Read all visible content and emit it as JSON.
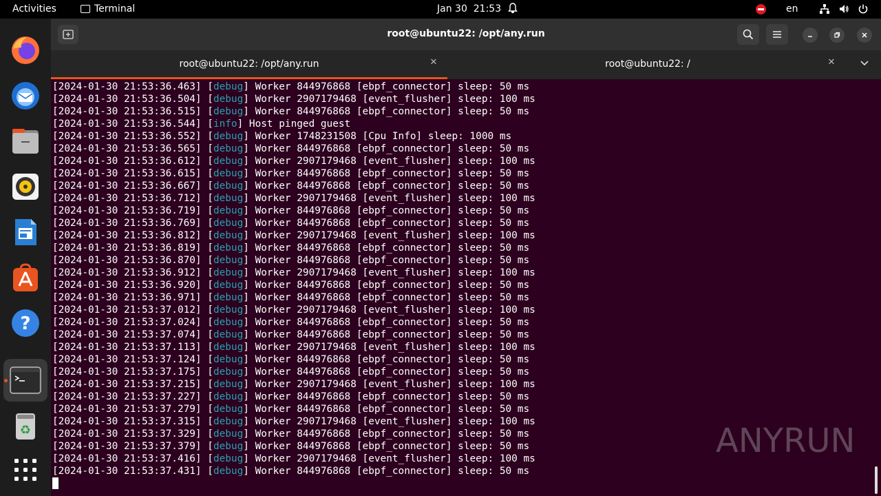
{
  "topbar": {
    "activities": "Activities",
    "app_name": "Terminal",
    "date": "Jan 30",
    "time": "21:53",
    "language": "en"
  },
  "dock": {
    "items": [
      "firefox-icon",
      "thunderbird-icon",
      "files-icon",
      "rhythmbox-icon",
      "libreoffice-writer-icon",
      "app-center-icon",
      "help-icon",
      "terminal-icon",
      "trash-icon",
      "show-apps-icon"
    ]
  },
  "window": {
    "title": "root@ubuntu22: /opt/any.run",
    "tabs": [
      {
        "label": "root@ubuntu22: /opt/any.run",
        "active": true
      },
      {
        "label": "root@ubuntu22: /",
        "active": false
      }
    ]
  },
  "terminal": {
    "lines": [
      {
        "ts": "[2024-01-30 21:53:36.463]",
        "level": "debug",
        "msg": "Worker 844976868 [ebpf_connector] sleep: 50 ms"
      },
      {
        "ts": "[2024-01-30 21:53:36.504]",
        "level": "debug",
        "msg": "Worker 2907179468 [event_flusher] sleep: 100 ms"
      },
      {
        "ts": "[2024-01-30 21:53:36.515]",
        "level": "debug",
        "msg": "Worker 844976868 [ebpf_connector] sleep: 50 ms"
      },
      {
        "ts": "[2024-01-30 21:53:36.544]",
        "level": "info",
        "msg": "Host pinged guest"
      },
      {
        "ts": "[2024-01-30 21:53:36.552]",
        "level": "debug",
        "msg": "Worker 1748231508 [Cpu Info] sleep: 1000 ms"
      },
      {
        "ts": "[2024-01-30 21:53:36.565]",
        "level": "debug",
        "msg": "Worker 844976868 [ebpf_connector] sleep: 50 ms"
      },
      {
        "ts": "[2024-01-30 21:53:36.612]",
        "level": "debug",
        "msg": "Worker 2907179468 [event_flusher] sleep: 100 ms"
      },
      {
        "ts": "[2024-01-30 21:53:36.615]",
        "level": "debug",
        "msg": "Worker 844976868 [ebpf_connector] sleep: 50 ms"
      },
      {
        "ts": "[2024-01-30 21:53:36.667]",
        "level": "debug",
        "msg": "Worker 844976868 [ebpf_connector] sleep: 50 ms"
      },
      {
        "ts": "[2024-01-30 21:53:36.712]",
        "level": "debug",
        "msg": "Worker 2907179468 [event_flusher] sleep: 100 ms"
      },
      {
        "ts": "[2024-01-30 21:53:36.719]",
        "level": "debug",
        "msg": "Worker 844976868 [ebpf_connector] sleep: 50 ms"
      },
      {
        "ts": "[2024-01-30 21:53:36.769]",
        "level": "debug",
        "msg": "Worker 844976868 [ebpf_connector] sleep: 50 ms"
      },
      {
        "ts": "[2024-01-30 21:53:36.812]",
        "level": "debug",
        "msg": "Worker 2907179468 [event_flusher] sleep: 100 ms"
      },
      {
        "ts": "[2024-01-30 21:53:36.819]",
        "level": "debug",
        "msg": "Worker 844976868 [ebpf_connector] sleep: 50 ms"
      },
      {
        "ts": "[2024-01-30 21:53:36.870]",
        "level": "debug",
        "msg": "Worker 844976868 [ebpf_connector] sleep: 50 ms"
      },
      {
        "ts": "[2024-01-30 21:53:36.912]",
        "level": "debug",
        "msg": "Worker 2907179468 [event_flusher] sleep: 100 ms"
      },
      {
        "ts": "[2024-01-30 21:53:36.920]",
        "level": "debug",
        "msg": "Worker 844976868 [ebpf_connector] sleep: 50 ms"
      },
      {
        "ts": "[2024-01-30 21:53:36.971]",
        "level": "debug",
        "msg": "Worker 844976868 [ebpf_connector] sleep: 50 ms"
      },
      {
        "ts": "[2024-01-30 21:53:37.012]",
        "level": "debug",
        "msg": "Worker 2907179468 [event_flusher] sleep: 100 ms"
      },
      {
        "ts": "[2024-01-30 21:53:37.024]",
        "level": "debug",
        "msg": "Worker 844976868 [ebpf_connector] sleep: 50 ms"
      },
      {
        "ts": "[2024-01-30 21:53:37.074]",
        "level": "debug",
        "msg": "Worker 844976868 [ebpf_connector] sleep: 50 ms"
      },
      {
        "ts": "[2024-01-30 21:53:37.113]",
        "level": "debug",
        "msg": "Worker 2907179468 [event_flusher] sleep: 100 ms"
      },
      {
        "ts": "[2024-01-30 21:53:37.124]",
        "level": "debug",
        "msg": "Worker 844976868 [ebpf_connector] sleep: 50 ms"
      },
      {
        "ts": "[2024-01-30 21:53:37.175]",
        "level": "debug",
        "msg": "Worker 844976868 [ebpf_connector] sleep: 50 ms"
      },
      {
        "ts": "[2024-01-30 21:53:37.215]",
        "level": "debug",
        "msg": "Worker 2907179468 [event_flusher] sleep: 100 ms"
      },
      {
        "ts": "[2024-01-30 21:53:37.227]",
        "level": "debug",
        "msg": "Worker 844976868 [ebpf_connector] sleep: 50 ms"
      },
      {
        "ts": "[2024-01-30 21:53:37.279]",
        "level": "debug",
        "msg": "Worker 844976868 [ebpf_connector] sleep: 50 ms"
      },
      {
        "ts": "[2024-01-30 21:53:37.315]",
        "level": "debug",
        "msg": "Worker 2907179468 [event_flusher] sleep: 100 ms"
      },
      {
        "ts": "[2024-01-30 21:53:37.329]",
        "level": "debug",
        "msg": "Worker 844976868 [ebpf_connector] sleep: 50 ms"
      },
      {
        "ts": "[2024-01-30 21:53:37.379]",
        "level": "debug",
        "msg": "Worker 844976868 [ebpf_connector] sleep: 50 ms"
      },
      {
        "ts": "[2024-01-30 21:53:37.416]",
        "level": "debug",
        "msg": "Worker 2907179468 [event_flusher] sleep: 100 ms"
      },
      {
        "ts": "[2024-01-30 21:53:37.431]",
        "level": "debug",
        "msg": "Worker 844976868 [ebpf_connector] sleep: 50 ms"
      }
    ]
  },
  "watermark": {
    "text_left": "ANY",
    "text_right": "RUN"
  },
  "colors": {
    "terminal_bg": "#2c001e",
    "level_color": "#2aa1b3",
    "accent": "#e95420"
  }
}
